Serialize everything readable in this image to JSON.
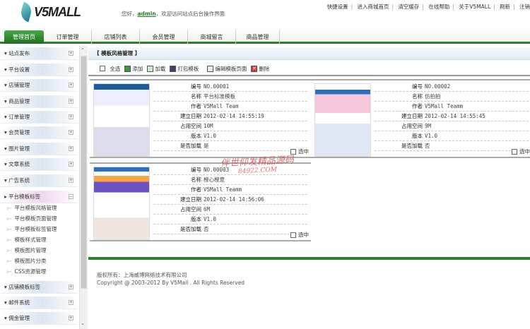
{
  "header": {
    "logo": "V5MALL",
    "welcome_prefix": "您好，",
    "user": "admin",
    "welcome_suffix": "，欢迎访问站点后台操作界面",
    "links": [
      "快捷设置",
      "进入商城首页",
      "清空缓存",
      "在线帮助",
      "关于V5MALL",
      "刷新",
      "注销"
    ]
  },
  "tabs": [
    "管理首页",
    "订单管理",
    "店铺列表",
    "会员管理",
    "商城留言",
    "商品管理"
  ],
  "sidebar": {
    "items_top": [
      "站点发布",
      "平台设置",
      "店铺管理",
      "商品管理",
      "订单管理",
      "会员管理",
      "图片管理",
      "文章系统",
      "广告系统"
    ],
    "open_item": "平台模板标签",
    "sub_items": [
      "平台模板风格管理",
      "平台模板页面管理",
      "平台模板标签管理",
      "模板样式管理",
      "模板图片管理",
      "模板图片分类",
      "CSS资源管理"
    ],
    "items_bottom": [
      "店铺模板标签",
      "邮件系统",
      "佣金管理"
    ]
  },
  "main": {
    "title": "【 模板风格管理 】",
    "toolbar": {
      "select_all": "全选",
      "add": "添加",
      "load": "加载",
      "pack": "打包模板",
      "edit": "编辑模板页面",
      "delete": "删除"
    },
    "labels": {
      "id": "编号",
      "name": "名称",
      "author": "作者",
      "created": "建立日期",
      "size": "占用空间",
      "version": "版本",
      "loaded": "是否加载",
      "select": "选中"
    },
    "templates": [
      {
        "id": "NO.00001",
        "name": "平台标准模板",
        "author": "V5Mall Team",
        "created": "2012-02-14 14:55:19",
        "size": "10M",
        "version": "V1.0",
        "loaded": "是"
      },
      {
        "id": "NO.00002",
        "name": "仿拍拍",
        "author": "V5Mall Teamm",
        "created": "2012-02-14 14:55:45",
        "size": "9M",
        "version": "V1.0",
        "loaded": "否"
      },
      {
        "id": "NO.00003",
        "name": "橙心橙意",
        "author": "V5Mall Teamm",
        "created": "2012-02-14 14:56:06",
        "size": "6M",
        "version": "V1.0",
        "loaded": "否"
      }
    ]
  },
  "footer": {
    "owner": "版权所有：上海威博网络技术有限公司",
    "copyright": "Copyright @ 2003-2012 By V5Mall . All Rights Reserved"
  },
  "watermark": {
    "line1": "伴世仰发精品源码",
    "line2": "84922.COM"
  }
}
